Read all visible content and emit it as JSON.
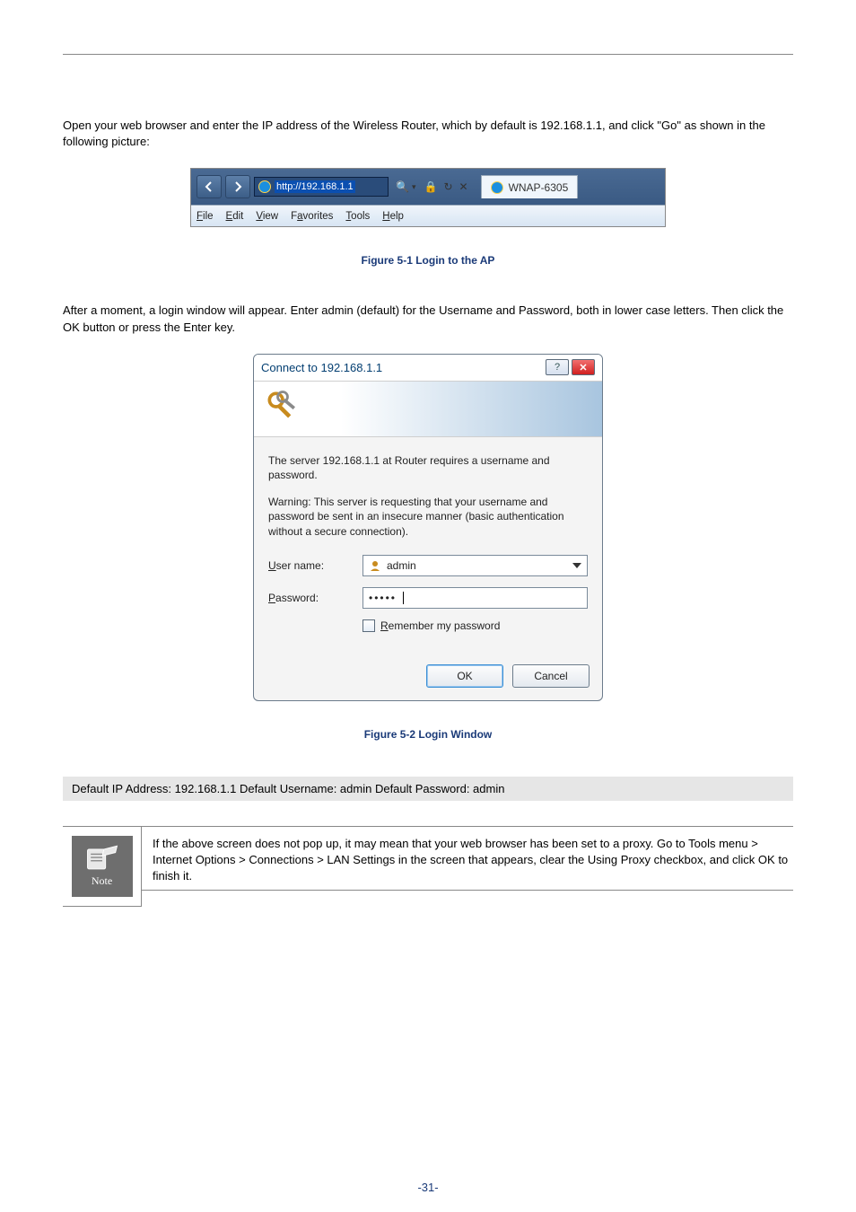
{
  "body": {
    "p1": "Open your web browser and enter the IP address of the Wireless Router, which by default is 192.168.1.1, and click \"Go\" as shown in the following picture:",
    "p2": "After a moment, a login window will appear. Enter admin (default) for the Username and Password, both in lower case letters. Then click the OK button or press the Enter key."
  },
  "browser": {
    "url": "http://192.168.1.1",
    "tab_title": "WNAP-6305",
    "icons_text": "ℓ − ☐ ↻ ✕",
    "menu": {
      "file": "File",
      "edit": "Edit",
      "view": "View",
      "favorites": "Favorites",
      "tools": "Tools",
      "help": "Help"
    }
  },
  "fig1_caption": "Figure 5-1 Login to the AP",
  "dialog": {
    "title": "Connect to 192.168.1.1",
    "prompt": "The server 192.168.1.1 at Router requires a username and password.",
    "warning": "Warning: This server is requesting that your username and password be sent in an insecure manner (basic authentication without a secure connection).",
    "labels": {
      "username": "User name:",
      "password": "Password:",
      "remember": "Remember my password"
    },
    "values": {
      "username": "admin",
      "password_mask": "•••••"
    },
    "buttons": {
      "ok": "OK",
      "cancel": "Cancel"
    }
  },
  "fig2_caption": "Figure 5-2 Login Window",
  "defaults_line": "Default IP Address: 192.168.1.1   Default Username: admin   Default Password: admin",
  "note_text": "If the above screen does not pop up, it may mean that your web browser has been set to a proxy. Go to Tools menu > Internet Options > Connections > LAN Settings in the screen that appears, clear the Using Proxy checkbox, and click OK to finish it.",
  "note_label": "Note",
  "page_number": "-31-"
}
